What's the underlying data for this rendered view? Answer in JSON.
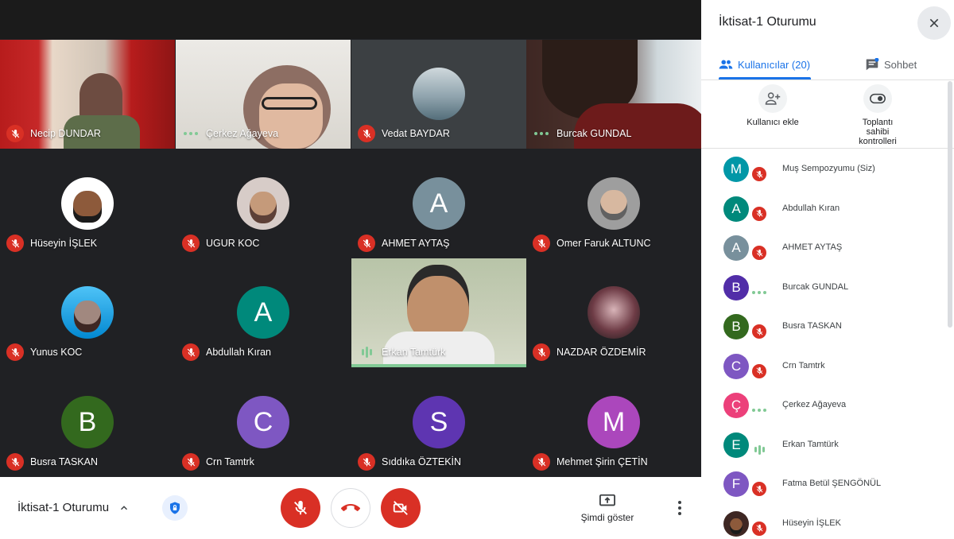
{
  "meeting": {
    "title": "İktisat-1 Oturumu"
  },
  "tiles": [
    {
      "name": "Necip DUNDAR",
      "status": "muted",
      "kind": "video"
    },
    {
      "name": "Çerkez Ağayeva",
      "status": "dots",
      "kind": "video"
    },
    {
      "name": "Vedat BAYDAR",
      "status": "muted",
      "kind": "photo"
    },
    {
      "name": "Burcak GUNDAL",
      "status": "dots",
      "kind": "video"
    },
    {
      "name": "Hüseyin İŞLEK",
      "status": "muted",
      "kind": "photo"
    },
    {
      "name": "UGUR KOC",
      "status": "muted",
      "kind": "photo"
    },
    {
      "name": "AHMET AYTAŞ",
      "status": "muted",
      "kind": "letter",
      "letter": "A",
      "color": "#78909c"
    },
    {
      "name": "Omer Faruk ALTUNC",
      "status": "muted",
      "kind": "photo"
    },
    {
      "name": "Yunus KOC",
      "status": "muted",
      "kind": "photo"
    },
    {
      "name": "Abdullah Kıran",
      "status": "muted",
      "kind": "letter",
      "letter": "A",
      "color": "#00897b"
    },
    {
      "name": "Erkan Tamtürk",
      "status": "speaking",
      "kind": "video"
    },
    {
      "name": "NAZDAR ÖZDEMİR",
      "status": "muted",
      "kind": "photo"
    },
    {
      "name": "Busra TASKAN",
      "status": "muted",
      "kind": "letter",
      "letter": "B",
      "color": "#33691e"
    },
    {
      "name": "Crn Tamtrk",
      "status": "muted",
      "kind": "letter",
      "letter": "C",
      "color": "#7e57c2"
    },
    {
      "name": "Sıddıka ÖZTEKİN",
      "status": "muted",
      "kind": "letter",
      "letter": "S",
      "color": "#5e35b1"
    },
    {
      "name": "Mehmet Şirin ÇETİN",
      "status": "muted",
      "kind": "letter",
      "letter": "M",
      "color": "#ab47bc"
    }
  ],
  "controls": {
    "present_label": "Şimdi göster"
  },
  "panel": {
    "title": "İktisat-1 Oturumu",
    "tab_people": "Kullanıcılar (20)",
    "tab_chat": "Sohbet",
    "add_people": "Kullanıcı ekle",
    "host_controls_1": "Toplantı",
    "host_controls_2": "sahibi",
    "host_controls_3": "kontrolleri"
  },
  "participants": [
    {
      "name": "Muş Sempozyumu (Siz)",
      "letter": "M",
      "color": "#0097a7",
      "status": "muted"
    },
    {
      "name": "Abdullah Kıran",
      "letter": "A",
      "color": "#00897b",
      "status": "muted"
    },
    {
      "name": "AHMET AYTAŞ",
      "letter": "A",
      "color": "#78909c",
      "status": "muted"
    },
    {
      "name": "Burcak GUNDAL",
      "letter": "B",
      "color": "#512da8",
      "status": "dots"
    },
    {
      "name": "Busra TASKAN",
      "letter": "B",
      "color": "#33691e",
      "status": "muted"
    },
    {
      "name": "Crn Tamtrk",
      "letter": "C",
      "color": "#7e57c2",
      "status": "muted"
    },
    {
      "name": "Çerkez Ağayeva",
      "letter": "Ç",
      "color": "#ec407a",
      "status": "dots"
    },
    {
      "name": "Erkan Tamtürk",
      "letter": "E",
      "color": "#00897b",
      "status": "speaking"
    },
    {
      "name": "Fatma Betül ŞENGÖNÜL",
      "letter": "F",
      "color": "#7e57c2",
      "status": "muted"
    },
    {
      "name": "Hüseyin İŞLEK",
      "letter": "",
      "color": "#3e2723",
      "status": "muted"
    }
  ]
}
